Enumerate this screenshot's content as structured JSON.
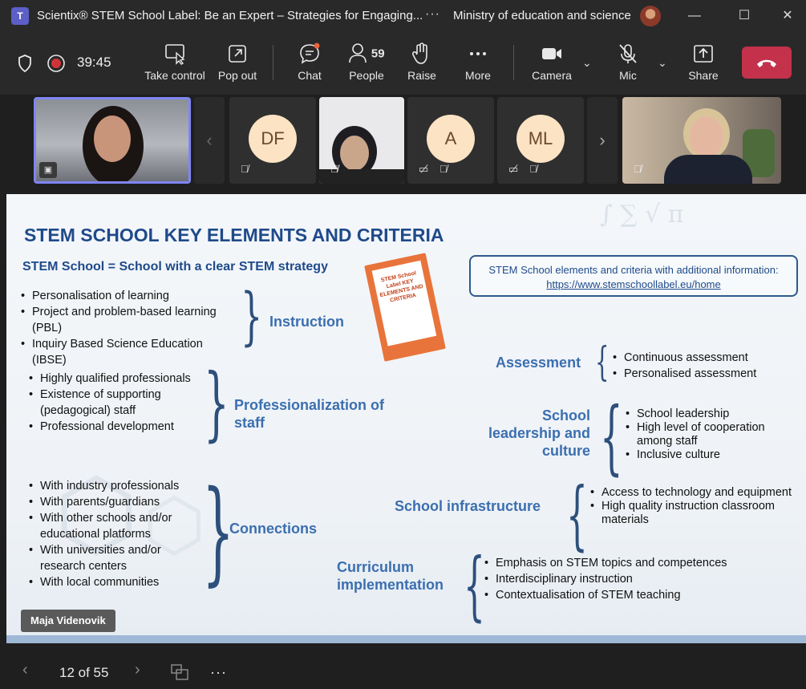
{
  "titlebar": {
    "app_icon": "teams-icon",
    "title": "Scientix® STEM School Label: Be an Expert – Strategies for Engaging...",
    "more": "···",
    "org": "Ministry of education and science",
    "minimize": "—",
    "maximize": "☐",
    "close": "✕"
  },
  "toolbar": {
    "timer": "39:45",
    "take_control": "Take control",
    "pop_out": "Pop out",
    "chat": "Chat",
    "people": "People",
    "people_count": "59",
    "raise": "Raise",
    "more": "More",
    "camera": "Camera",
    "mic": "Mic",
    "share": "Share"
  },
  "gallery": {
    "tiles": [
      {
        "initials": "DF"
      },
      {
        "initials": "A"
      },
      {
        "initials": "ML"
      }
    ]
  },
  "slide": {
    "title": "STEM SCHOOL KEY ELEMENTS AND CRITERIA",
    "subtitle": "STEM School = School with a clear STEM strategy",
    "link_box": {
      "line1": "STEM School elements and criteria with additional information:",
      "url": "https://www.stemschoollabel.eu/home"
    },
    "booklet_text": "STEM School Label KEY ELEMENTS AND CRITERIA",
    "instruction": {
      "label": "Instruction",
      "items": [
        "Personalisation of learning",
        "Project and problem-based learning (PBL)",
        "Inquiry Based Science Education (IBSE)"
      ]
    },
    "professionalization": {
      "label": "Professionalization of staff",
      "items": [
        "Highly qualified professionals",
        "Existence of supporting (pedagogical) staff",
        "Professional development"
      ]
    },
    "connections": {
      "label": "Connections",
      "items": [
        "With industry professionals",
        "With parents/guardians",
        "With other schools and/or educational platforms",
        "With universities and/or research centers",
        "With local communities"
      ]
    },
    "assessment": {
      "label": "Assessment",
      "items": [
        "Continuous assessment",
        "Personalised assessment"
      ]
    },
    "leadership": {
      "label": "School leadership and culture",
      "items": [
        "School leadership",
        "High level of cooperation among staff",
        "Inclusive culture"
      ]
    },
    "infrastructure": {
      "label": "School infrastructure",
      "items": [
        "Access to technology and equipment",
        "High quality instruction classroom materials"
      ]
    },
    "curriculum": {
      "label": "Curriculum implementation",
      "items": [
        "Emphasis on STEM topics and competences",
        "Interdisciplinary instruction",
        "Contextualisation of STEM teaching"
      ]
    },
    "presenter": "Maja Videnovik"
  },
  "bottombar": {
    "page": "12 of 55",
    "more": "···"
  }
}
